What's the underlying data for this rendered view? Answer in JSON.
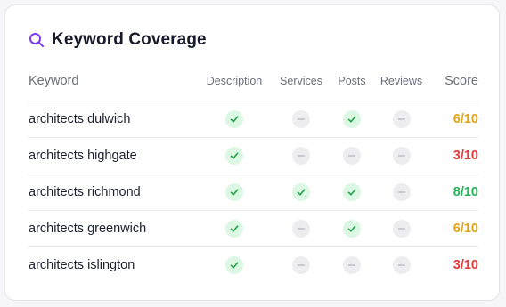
{
  "header": {
    "title": "Keyword Coverage",
    "icon": "search-icon",
    "icon_color": "#7c3aed"
  },
  "columns": {
    "keyword": "Keyword",
    "description": "Description",
    "services": "Services",
    "posts": "Posts",
    "reviews": "Reviews",
    "score": "Score"
  },
  "colors": {
    "check": "#22a14a",
    "check_bg": "#dcf7e3",
    "dash": "#b4b6be",
    "dash_bg": "#ededf0",
    "score_high": "#27b357",
    "score_mid": "#e0a419",
    "score_low": "#e23b3b"
  },
  "rows": [
    {
      "keyword": "architects dulwich",
      "description": true,
      "services": false,
      "posts": true,
      "reviews": false,
      "score": "6/10",
      "score_level": "mid"
    },
    {
      "keyword": "architects highgate",
      "description": true,
      "services": false,
      "posts": false,
      "reviews": false,
      "score": "3/10",
      "score_level": "low"
    },
    {
      "keyword": "architects richmond",
      "description": true,
      "services": true,
      "posts": true,
      "reviews": false,
      "score": "8/10",
      "score_level": "high"
    },
    {
      "keyword": "architects greenwich",
      "description": true,
      "services": false,
      "posts": true,
      "reviews": false,
      "score": "6/10",
      "score_level": "mid"
    },
    {
      "keyword": "architects islington",
      "description": true,
      "services": false,
      "posts": false,
      "reviews": false,
      "score": "3/10",
      "score_level": "low"
    }
  ]
}
